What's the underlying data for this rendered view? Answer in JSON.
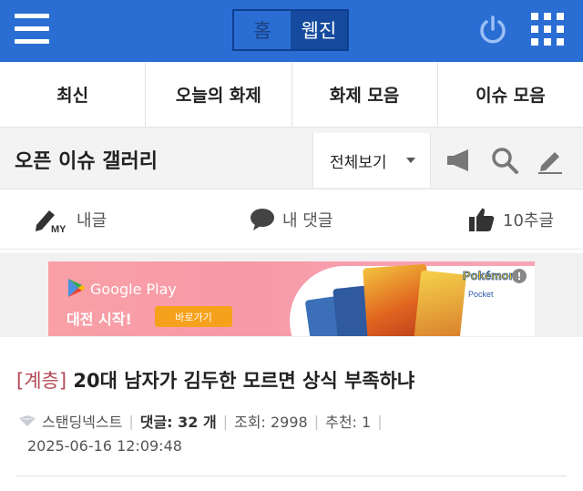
{
  "topbar": {
    "menu_icon": "hamburger-menu-icon",
    "segment": {
      "home_label": "홈",
      "webzine_label": "웹진"
    },
    "power_icon": "power-icon",
    "grid_icon": "grid-apps-icon",
    "accent_color": "#2a6dd3"
  },
  "tabs": [
    {
      "label": "최신"
    },
    {
      "label": "오늘의 화제"
    },
    {
      "label": "화제 모음"
    },
    {
      "label": "이슈 모음"
    }
  ],
  "gallery": {
    "title": "오픈 이슈 갤러리",
    "view_select": "전체보기",
    "icons": [
      "megaphone-icon",
      "search-icon",
      "pencil-icon"
    ]
  },
  "actions": {
    "my_posts": "내글",
    "my_comments": "내 댓글",
    "recommended": "10추글",
    "my_badge": "MY"
  },
  "ad": {
    "store": "Google Play",
    "tagline": "대전 시작!",
    "button": "바로가기",
    "brand": "Pokémon",
    "brand_sub": "Pocket"
  },
  "post": {
    "category": "[계층]",
    "title": "20대 남자가 김두한 모르면 상식 부족하냐",
    "author": "스탠딩넥스트",
    "comments_label": "댓글: 32 개",
    "views_label": "조회: 2998",
    "recommend_label": "추천: 1",
    "datetime": "2025-06-16 12:09:48"
  }
}
